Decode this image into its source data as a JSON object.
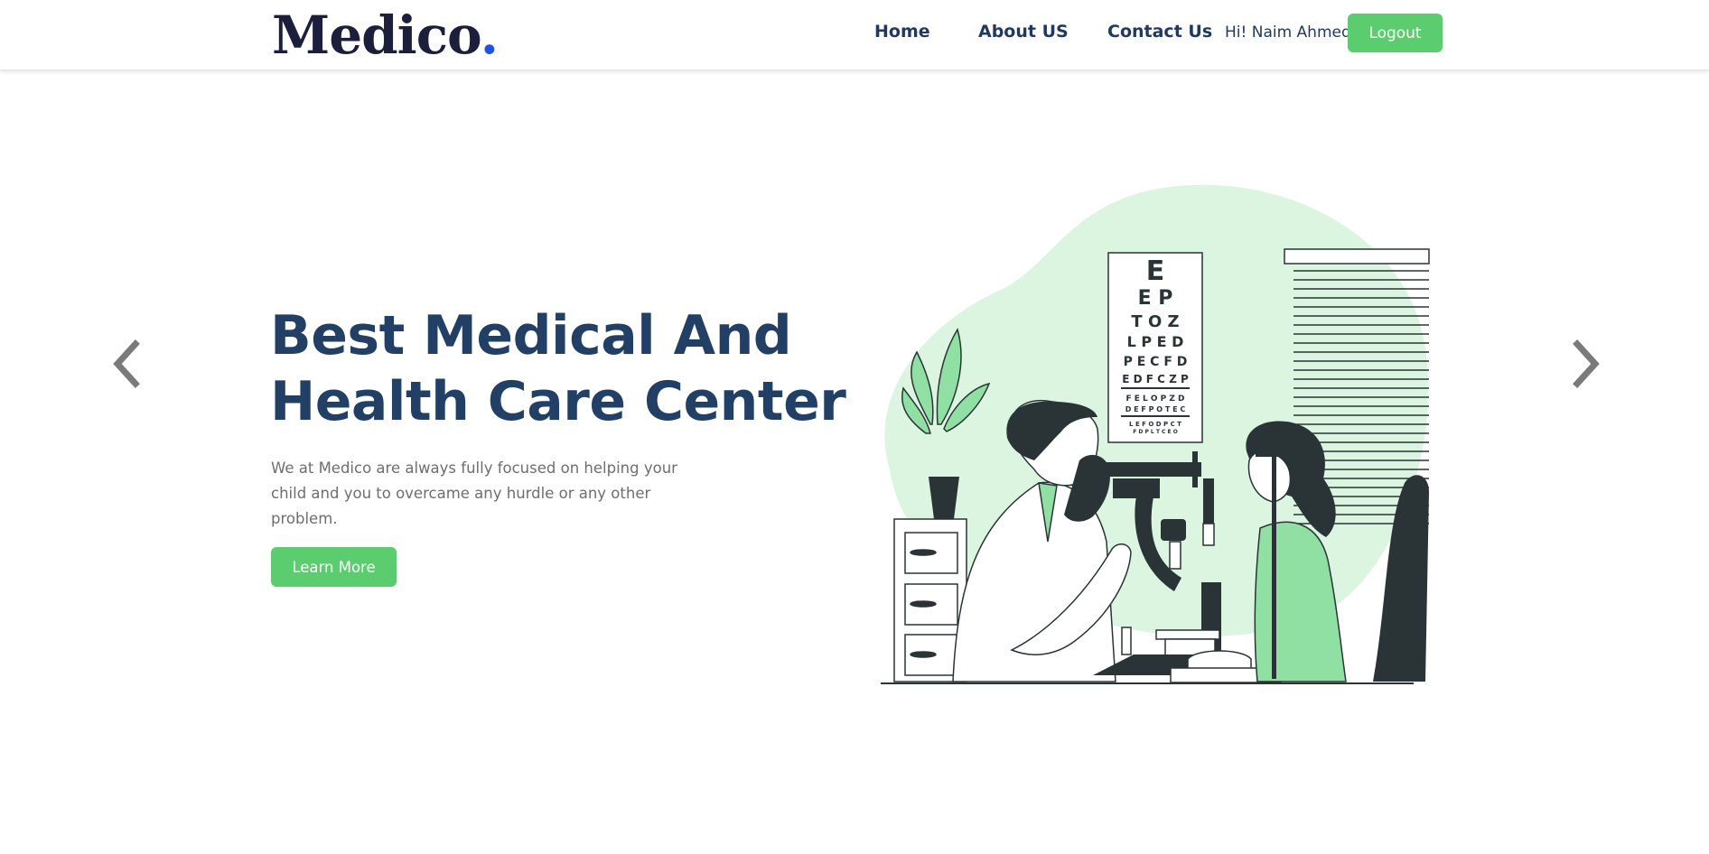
{
  "header": {
    "logo_text": "Medico",
    "logo_dot": ".",
    "nav": {
      "home": "Home",
      "about": "About US",
      "contact": "Contact Us"
    },
    "greeting": "Hi! Naim Ahmed",
    "logout_label": "Logout"
  },
  "hero": {
    "title_line1": "Best Medical And",
    "title_line2": "Health Care Center",
    "description": "We at Medico are always fully focused on helping your child and you to overcame any hurdle or any other problem.",
    "button_label": "Learn More"
  },
  "carousel": {
    "prev_icon": "chevron-left-icon",
    "next_icon": "chevron-right-icon"
  },
  "eye_chart": {
    "rows": [
      "E",
      "E P",
      "T O Z",
      "L P E D",
      "P E C F D",
      "E D F C Z P",
      "F E L O P Z D",
      "D E F P O T E C",
      "L E F O D P C T",
      "F D P L T C E O"
    ]
  },
  "colors": {
    "brand_green": "#5ccd6e",
    "heading_navy": "#223f66",
    "logo_dot_blue": "#1c52e8",
    "blob_green": "#dcf5e1"
  }
}
